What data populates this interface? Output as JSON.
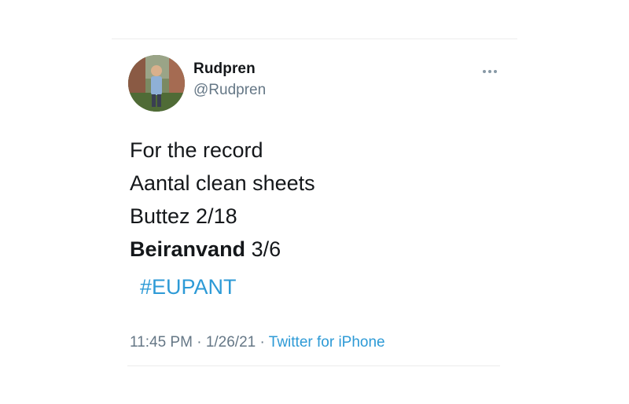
{
  "author": {
    "display_name": "Rudpren",
    "handle": "@Rudpren",
    "avatar_icon": "profile-photo"
  },
  "more_icon": "more-dots-icon",
  "tweet": {
    "lines": [
      {
        "text": "For the record"
      },
      {
        "text": "Aantal clean sheets"
      },
      {
        "text": "Buttez 2/18"
      },
      {
        "bold": "Beiranvand",
        "rest": " 3/6"
      }
    ],
    "hashtag": "#EUPANT"
  },
  "meta": {
    "time": "11:45 PM",
    "separator": " · ",
    "date": "1/26/21",
    "source": "Twitter for iPhone"
  },
  "colors": {
    "text": "#14171a",
    "secondary": "#657786",
    "link": "#2d9ad6"
  }
}
